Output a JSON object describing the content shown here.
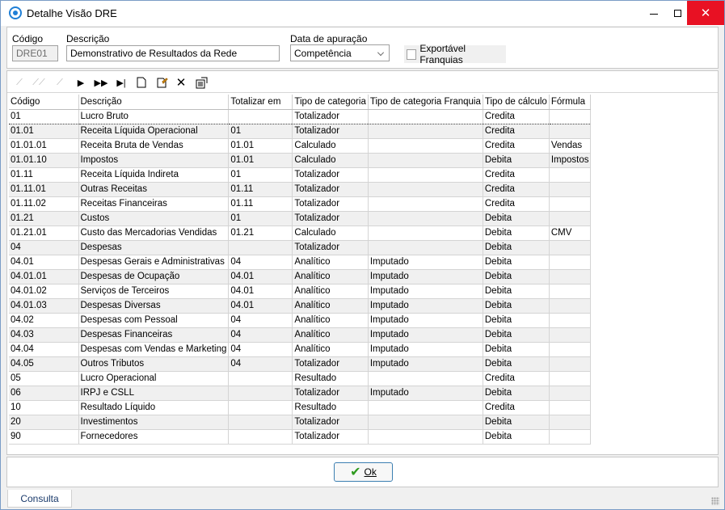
{
  "window": {
    "title": "Detalhe Visão DRE"
  },
  "header": {
    "codigo_label": "Código",
    "codigo_value": "DRE01",
    "descricao_label": "Descrição",
    "descricao_value": "Demonstrativo de Resultados da Rede",
    "data_apuracao_label": "Data de apuração",
    "data_apuracao_value": "Competência",
    "exportavel_label": "Exportável Franquias"
  },
  "grid": {
    "columns": [
      "Código",
      "Descrição",
      "Totalizar em",
      "Tipo de categoria",
      "Tipo de categoria Franquia",
      "Tipo de cálculo",
      "Fórmula"
    ],
    "rows": [
      [
        "01",
        "Lucro Bruto",
        "",
        "Totalizador",
        "",
        "Credita",
        ""
      ],
      [
        "01.01",
        "Receita Líquida Operacional",
        "01",
        "Totalizador",
        "",
        "Credita",
        ""
      ],
      [
        "01.01.01",
        "Receita Bruta de Vendas",
        "01.01",
        "Calculado",
        "",
        "Credita",
        "Vendas"
      ],
      [
        "01.01.10",
        "Impostos",
        "01.01",
        "Calculado",
        "",
        "Debita",
        "Impostos"
      ],
      [
        "01.11",
        "Receita Líquida Indireta",
        "01",
        "Totalizador",
        "",
        "Credita",
        ""
      ],
      [
        "01.11.01",
        "Outras Receitas",
        "01.11",
        "Totalizador",
        "",
        "Credita",
        ""
      ],
      [
        "01.11.02",
        "Receitas Financeiras",
        "01.11",
        "Totalizador",
        "",
        "Credita",
        ""
      ],
      [
        "01.21",
        "Custos",
        "01",
        "Totalizador",
        "",
        "Debita",
        ""
      ],
      [
        "01.21.01",
        "Custo das Mercadorias Vendidas",
        "01.21",
        "Calculado",
        "",
        "Debita",
        "CMV"
      ],
      [
        "04",
        "Despesas",
        "",
        "Totalizador",
        "",
        "Debita",
        ""
      ],
      [
        "04.01",
        "Despesas Gerais e Administrativas",
        "04",
        "Analítico",
        "Imputado",
        "Debita",
        ""
      ],
      [
        "04.01.01",
        "Despesas de Ocupação",
        "04.01",
        "Analítico",
        "Imputado",
        "Debita",
        ""
      ],
      [
        "04.01.02",
        "Serviços de Terceiros",
        "04.01",
        "Analítico",
        "Imputado",
        "Debita",
        ""
      ],
      [
        "04.01.03",
        "Despesas Diversas",
        "04.01",
        "Analítico",
        "Imputado",
        "Debita",
        ""
      ],
      [
        "04.02",
        "Despesas com Pessoal",
        "04",
        "Analítico",
        "Imputado",
        "Debita",
        ""
      ],
      [
        "04.03",
        "Despesas Financeiras",
        "04",
        "Analítico",
        "Imputado",
        "Debita",
        ""
      ],
      [
        "04.04",
        "Despesas com Vendas e Marketing",
        "04",
        "Analítico",
        "Imputado",
        "Debita",
        ""
      ],
      [
        "04.05",
        "Outros Tributos",
        "04",
        "Totalizador",
        "Imputado",
        "Debita",
        ""
      ],
      [
        "05",
        "Lucro Operacional",
        "",
        "Resultado",
        "",
        "Credita",
        ""
      ],
      [
        "06",
        "IRPJ e CSLL",
        "",
        "Totalizador",
        "Imputado",
        "Debita",
        ""
      ],
      [
        "10",
        "Resultado Líquido",
        "",
        "Resultado",
        "",
        "Credita",
        ""
      ],
      [
        "20",
        "Investimentos",
        "",
        "Totalizador",
        "",
        "Debita",
        ""
      ],
      [
        "90",
        "Fornecedores",
        "",
        "Totalizador",
        "",
        "Debita",
        ""
      ]
    ]
  },
  "footer": {
    "ok_label": "Ok",
    "status_tab": "Consulta"
  }
}
